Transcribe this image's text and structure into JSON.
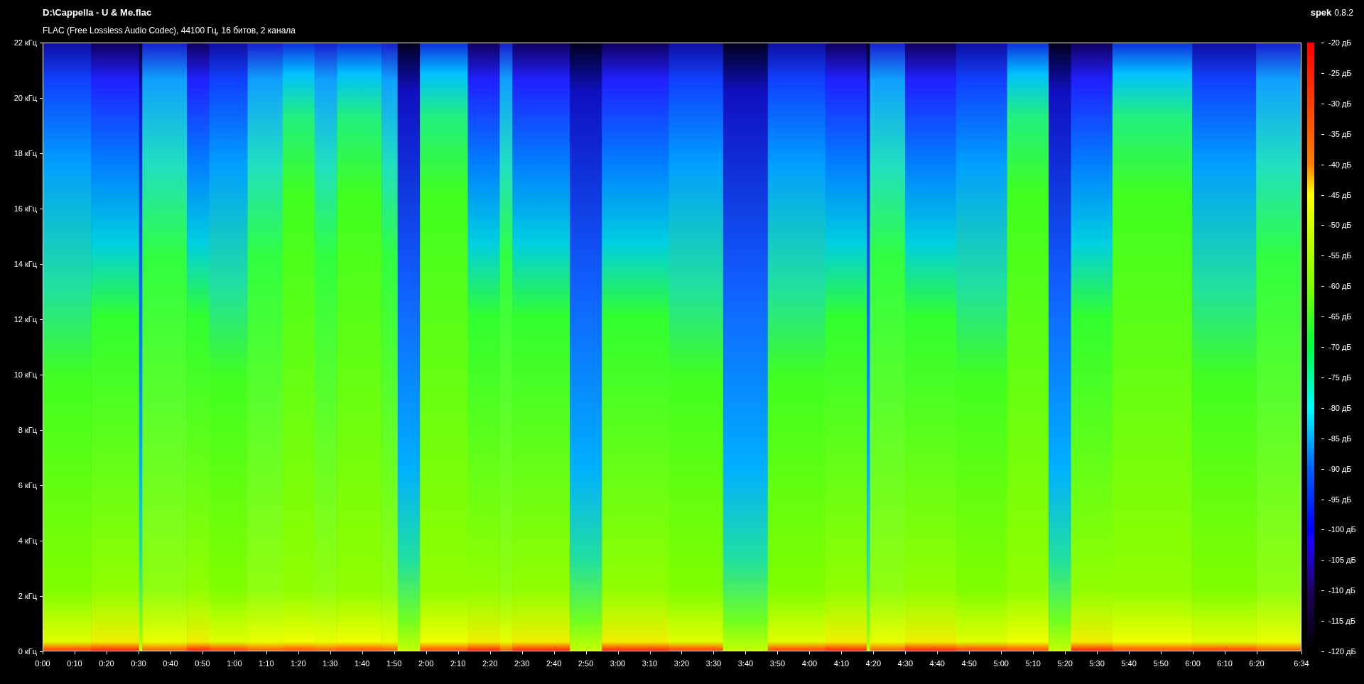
{
  "file": {
    "title": "D:\\Cappella - U & Me.flac",
    "info": "FLAC (Free Lossless Audio Codec), 44100 Гц, 16 битов, 2 канала"
  },
  "app": {
    "name": "spek",
    "version": "0.8.2"
  },
  "frequency_axis": {
    "labels": [
      "22 кГц",
      "20 кГц",
      "18 кГц",
      "16 кГц",
      "14 кГц",
      "12 кГц",
      "10 кГц",
      "8 кГц",
      "6 кГц",
      "4 кГц",
      "2 кГц",
      "0 кГц"
    ]
  },
  "time_axis": {
    "labels": [
      "0:00",
      "0:10",
      "0:20",
      "0:30",
      "0:40",
      "0:50",
      "1:00",
      "1:10",
      "1:20",
      "1:30",
      "1:40",
      "1:50",
      "2:00",
      "2:10",
      "2:20",
      "2:30",
      "2:40",
      "2:50",
      "3:00",
      "3:10",
      "3:20",
      "3:30",
      "3:40",
      "3:50",
      "4:00",
      "4:10",
      "4:20",
      "4:30",
      "4:40",
      "4:50",
      "5:00",
      "5:10",
      "5:20",
      "5:30",
      "5:40",
      "5:50",
      "6:00",
      "6:10",
      "6:20",
      "6:34"
    ]
  },
  "level_scale": {
    "labels": [
      "-20 дБ",
      "-25 дБ",
      "-30 дБ",
      "-35 дБ",
      "-40 дБ",
      "-45 дБ",
      "-50 дБ",
      "-55 дБ",
      "-60 дБ",
      "-65 дБ",
      "-70 дБ",
      "-75 дБ",
      "-80 дБ",
      "-85 дБ",
      "-90 дБ",
      "-95 дБ",
      "-100 дБ",
      "-105 дБ",
      "-110 дБ",
      "-115 дБ",
      "-120 дБ"
    ]
  }
}
